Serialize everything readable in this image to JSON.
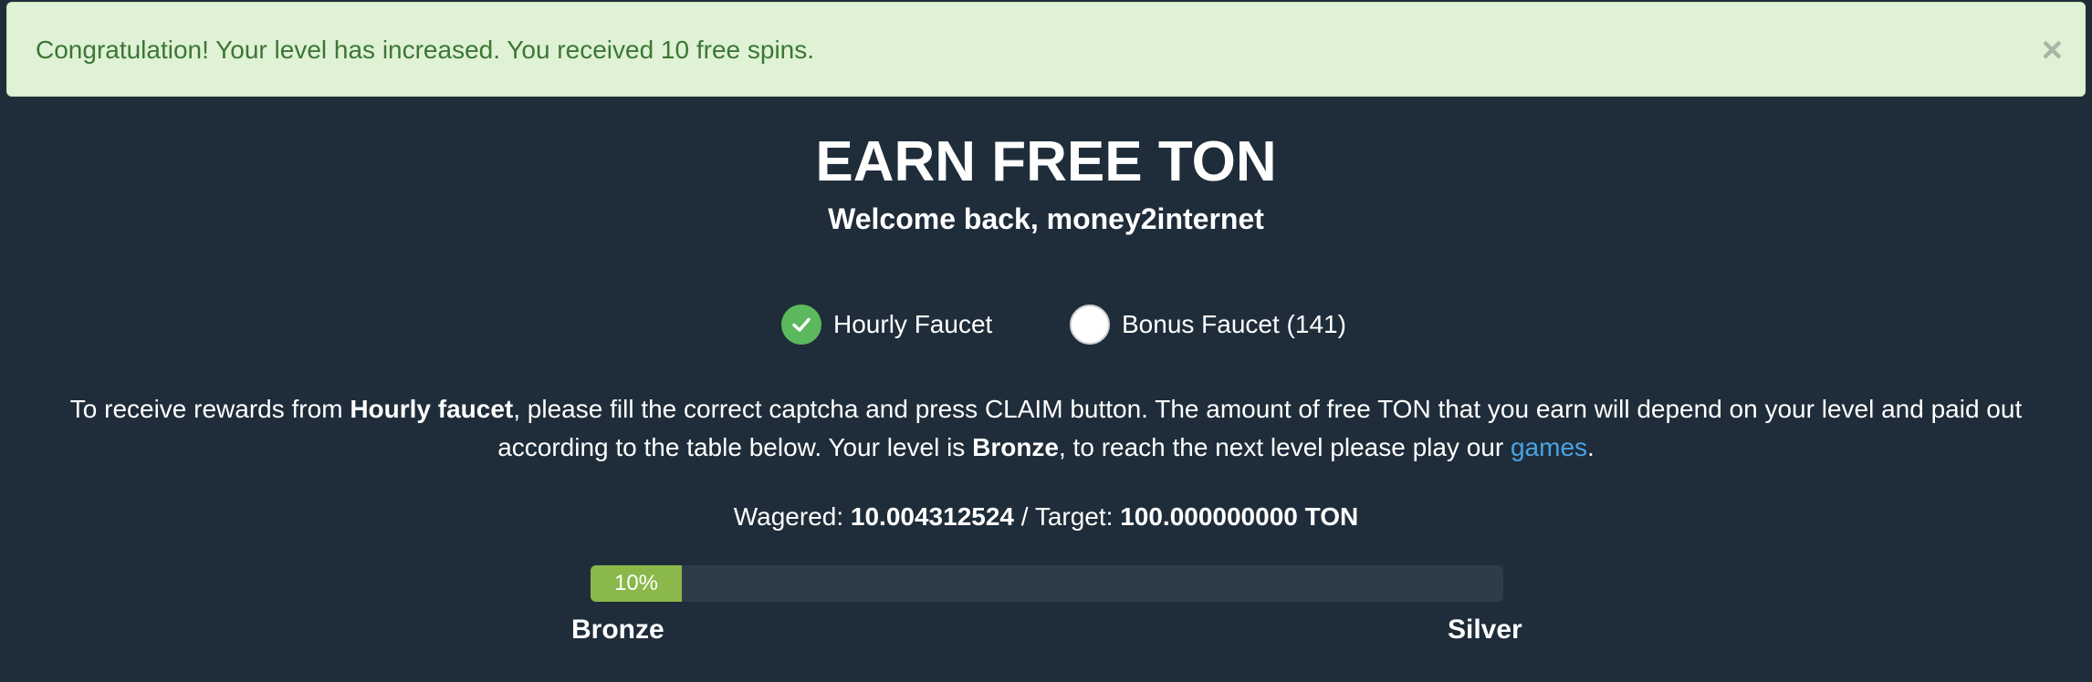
{
  "alert": {
    "message": "Congratulation! Your level has increased. You received 10 free spins.",
    "close_glyph": "×"
  },
  "header": {
    "title": "EARN FREE TON",
    "welcome": "Welcome back, money2internet"
  },
  "faucets": [
    {
      "label": "Hourly Faucet",
      "selected": true
    },
    {
      "label": "Bonus Faucet (141)",
      "selected": false
    }
  ],
  "description": {
    "part1": "To receive rewards from ",
    "faucet_name": "Hourly faucet",
    "part2": ", please fill the correct captcha and press CLAIM button. The amount of free TON that you earn will depend on your level and paid out according to the table below. Your level is ",
    "level": "Bronze",
    "part3": ", to reach the next level please play our ",
    "link_text": "games",
    "part4": "."
  },
  "wager": {
    "wagered_label": "Wagered: ",
    "wagered_value": "10.004312524",
    "separator": " / Target: ",
    "target_value": "100.000000000 TON"
  },
  "progress": {
    "percent": 10,
    "label": "10%",
    "from_level": "Bronze",
    "to_level": "Silver"
  },
  "colors": {
    "background": "#1f2d3a",
    "alert_bg": "#dff2d5",
    "alert_text": "#3c7636",
    "check_green": "#5cb85c",
    "progress_fill": "#8ab84a",
    "link": "#4ba3e3"
  }
}
